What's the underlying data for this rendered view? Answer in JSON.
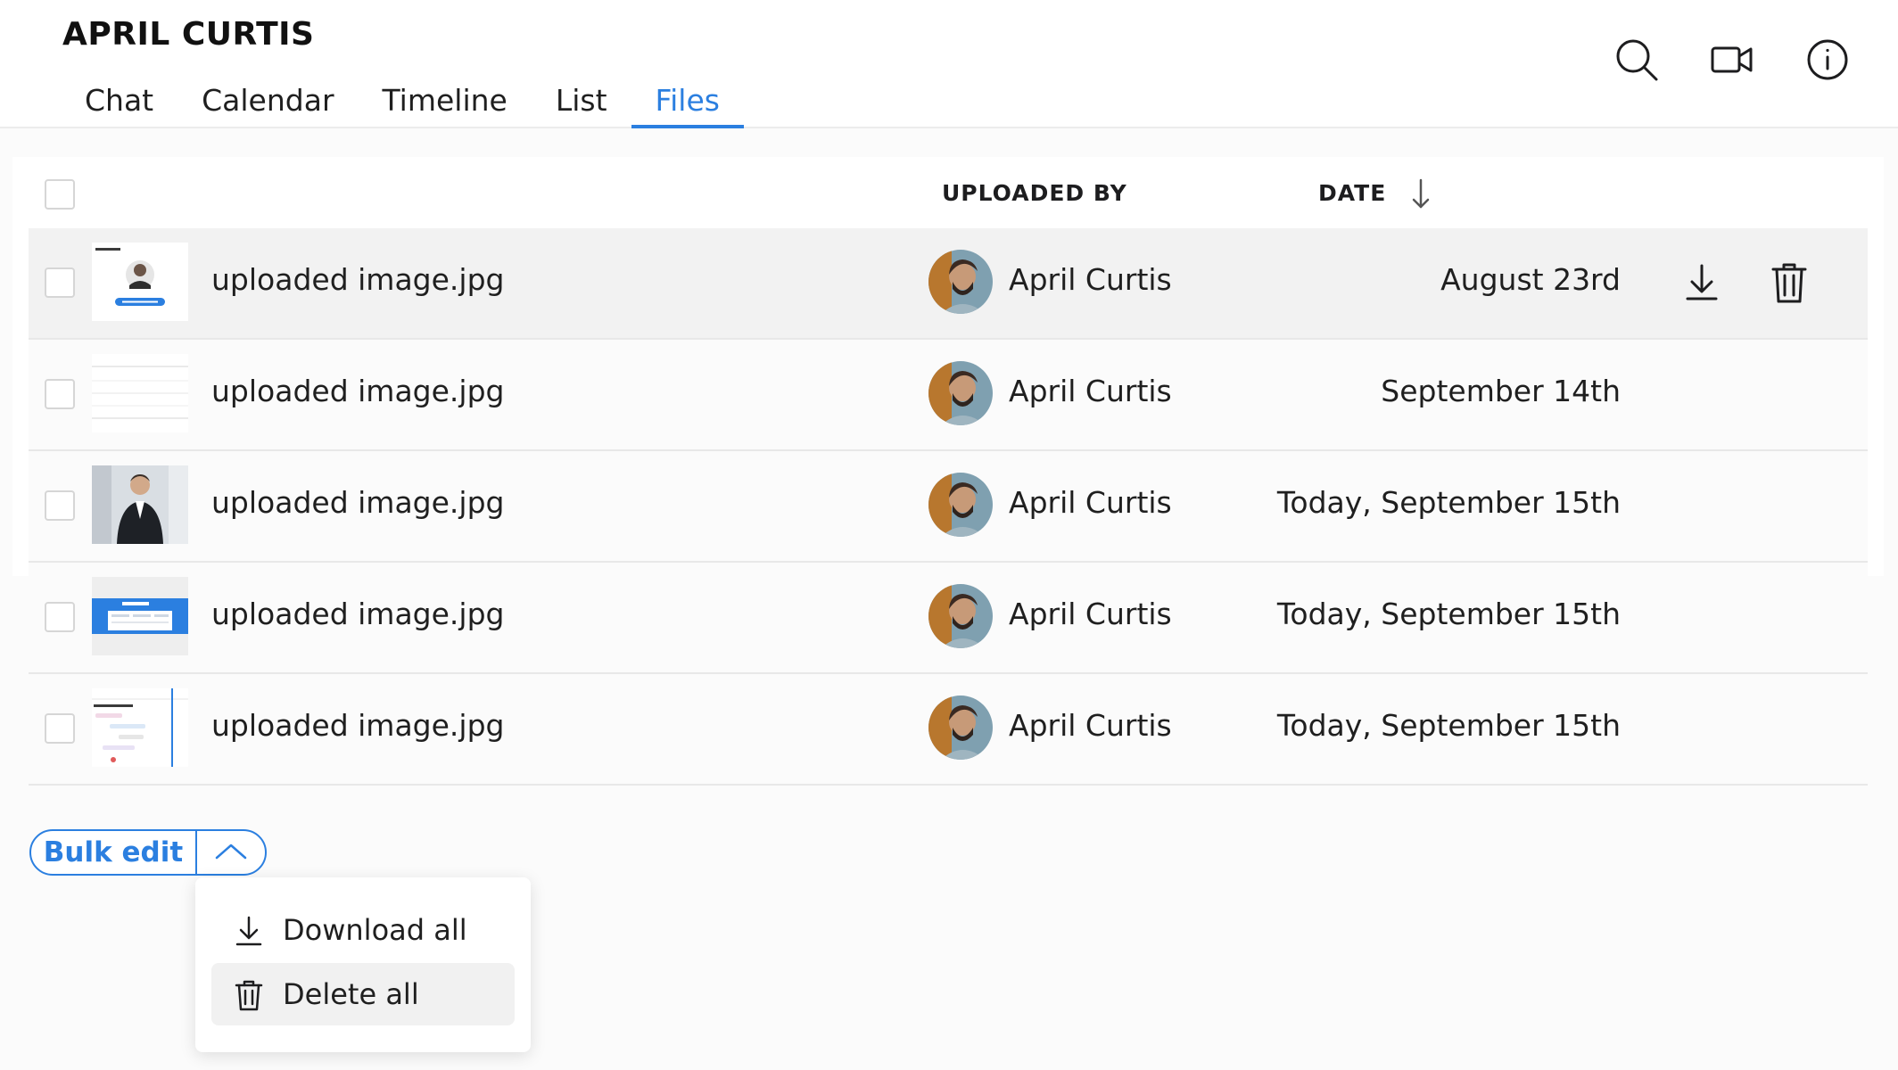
{
  "header": {
    "title": "APRIL CURTIS",
    "tabs": [
      {
        "label": "Chat",
        "active": false
      },
      {
        "label": "Calendar",
        "active": false
      },
      {
        "label": "Timeline",
        "active": false
      },
      {
        "label": "List",
        "active": false
      },
      {
        "label": "Files",
        "active": true
      }
    ],
    "icons": [
      "search-icon",
      "video-camera-icon",
      "info-icon"
    ],
    "accent_color": "#2b7fe0"
  },
  "table": {
    "columns": {
      "uploaded_by": "UPLOADED BY",
      "date": "DATE"
    },
    "sort": {
      "column": "DATE",
      "direction": "descending",
      "icon": "arrow-down-icon"
    },
    "rows": [
      {
        "file_name": "uploaded image.jpg",
        "thumbnail": "avatar-settings-screenshot",
        "uploaded_by": "April Curtis",
        "date": "August 23rd",
        "hovered": true,
        "checked": false
      },
      {
        "file_name": "uploaded image.jpg",
        "thumbnail": "text-document-screenshot",
        "uploaded_by": "April Curtis",
        "date": "September 14th",
        "hovered": false,
        "checked": false
      },
      {
        "file_name": "uploaded image.jpg",
        "thumbnail": "portrait-photo",
        "uploaded_by": "April Curtis",
        "date": "Today, September 15th",
        "hovered": false,
        "checked": false
      },
      {
        "file_name": "uploaded image.jpg",
        "thumbnail": "blue-announcement-screenshot",
        "uploaded_by": "April Curtis",
        "date": "Today, September 15th",
        "hovered": false,
        "checked": false
      },
      {
        "file_name": "uploaded image.jpg",
        "thumbnail": "timeline-screenshot",
        "uploaded_by": "April Curtis",
        "date": "Today, September 15th",
        "hovered": false,
        "checked": false
      }
    ],
    "row_actions": [
      "download-icon",
      "trash-icon"
    ]
  },
  "bulk_edit": {
    "label": "Bulk edit",
    "toggle_icon": "chevron-up-icon",
    "menu": [
      {
        "label": "Download all",
        "icon": "download-icon"
      },
      {
        "label": "Delete all",
        "icon": "trash-icon"
      }
    ]
  }
}
